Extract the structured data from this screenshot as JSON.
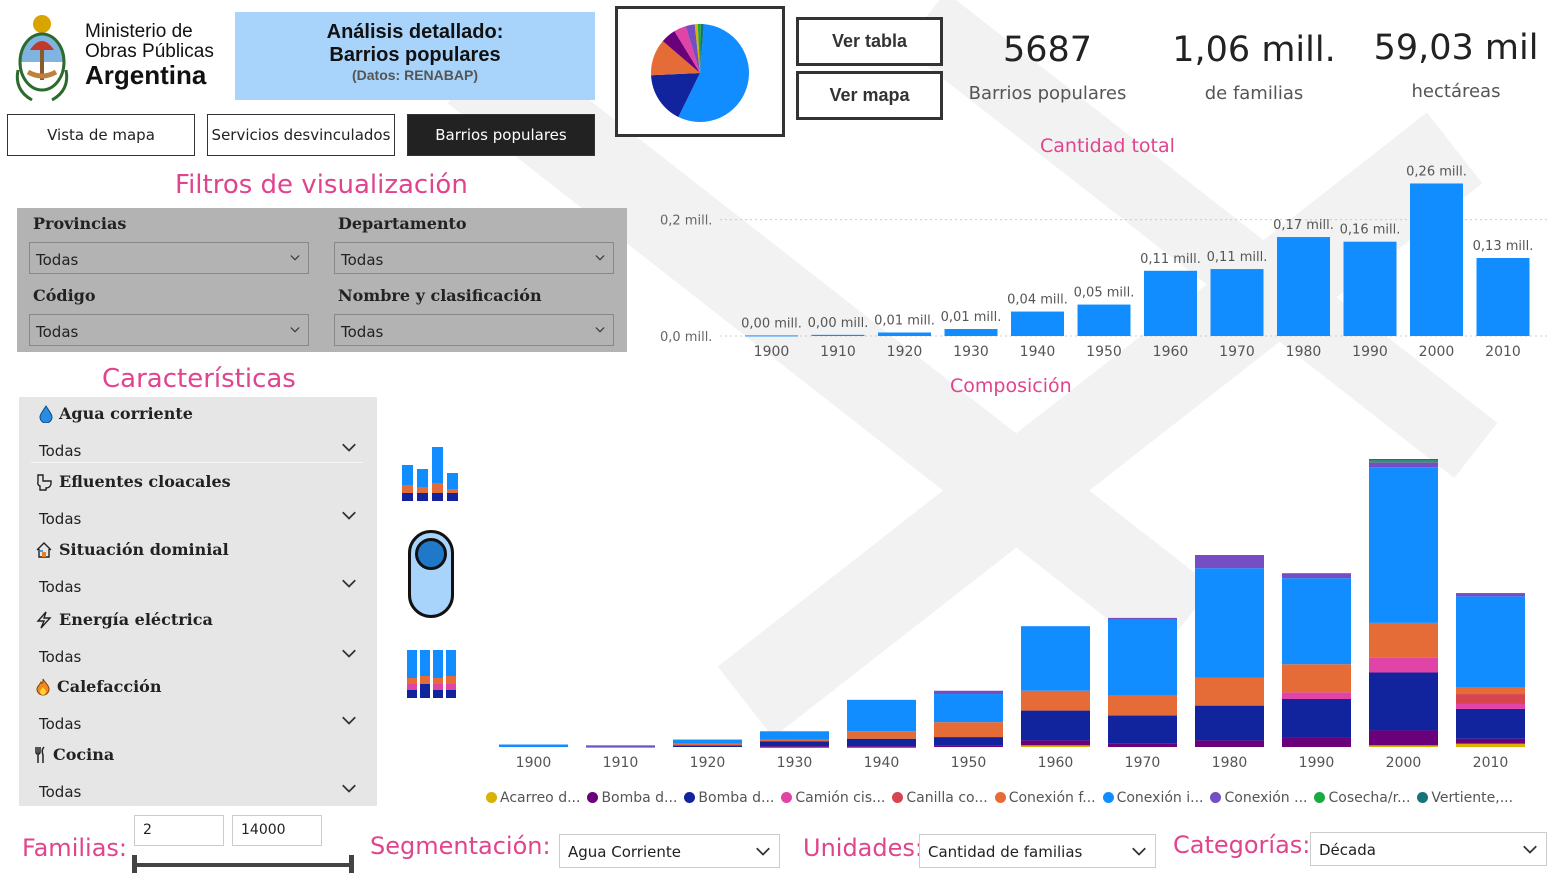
{
  "header": {
    "logo_line1": "Ministerio de",
    "logo_line2": "Obras Públicas",
    "logo_line3": "Argentina",
    "banner_title1": "Análisis detallado:",
    "banner_title2": "Barrios populares",
    "banner_sub": "(Datos: RENABAP)"
  },
  "nav": {
    "map_view": "Vista de mapa",
    "services": "Servicios desvinculados",
    "barrios": "Barrios populares"
  },
  "view_buttons": {
    "table": "Ver tabla",
    "map": "Ver mapa"
  },
  "kpis": [
    {
      "value": "5687",
      "label": "Barrios populares"
    },
    {
      "value": "1,06 mill.",
      "label": "de familias"
    },
    {
      "value": "59,03 mil",
      "label": "hectáreas"
    }
  ],
  "filters": {
    "title": "Filtros de visualización",
    "items": [
      {
        "label": "Provincias",
        "value": "Todas"
      },
      {
        "label": "Departamento",
        "value": "Todas"
      },
      {
        "label": "Código",
        "value": "Todas"
      },
      {
        "label": "Nombre y clasificación",
        "value": "Todas"
      }
    ]
  },
  "characteristics": {
    "title": "Características",
    "items": [
      {
        "label": "Agua corriente",
        "value": "Todas",
        "icon": "water-drop-icon"
      },
      {
        "label": "Efluentes cloacales",
        "value": "Todas",
        "icon": "toilet-icon"
      },
      {
        "label": "Situación dominial",
        "value": "Todas",
        "icon": "house-icon"
      },
      {
        "label": "Energía eléctrica",
        "value": "Todas",
        "icon": "lightning-icon"
      },
      {
        "label": "Calefacción",
        "value": "Todas",
        "icon": "fire-icon"
      },
      {
        "label": "Cocina",
        "value": "Todas",
        "icon": "utensils-icon"
      }
    ]
  },
  "bottom": {
    "familias_label": "Familias:",
    "familias_min": "2",
    "familias_max": "14000",
    "seg_label": "Segmentación:",
    "seg_value": "Agua Corriente",
    "units_label": "Unidades:",
    "units_value": "Cantidad de familias",
    "cat_label": "Categorías:",
    "cat_value": "Década"
  },
  "colors": {
    "blue": "#118dff",
    "navy": "#12239e",
    "orange": "#e66c37",
    "purple": "#6b007b",
    "pink": "#e044a7",
    "violet": "#744ec2",
    "yellow": "#d9b300",
    "red": "#d64550",
    "green": "#1aab40",
    "teal": "#197278",
    "accent_pink": "#e0448d"
  },
  "chart_data": [
    {
      "type": "bar",
      "title": "Cantidad total",
      "categories": [
        "1900",
        "1910",
        "1920",
        "1930",
        "1940",
        "1950",
        "1960",
        "1970",
        "1980",
        "1990",
        "2000",
        "2010"
      ],
      "values": [
        0.001,
        0.002,
        0.006,
        0.012,
        0.042,
        0.054,
        0.112,
        0.115,
        0.17,
        0.162,
        0.262,
        0.134
      ],
      "data_labels": [
        "0,00 mill.",
        "0,00 mill.",
        "0,01 mill.",
        "0,01 mill.",
        "0,04 mill.",
        "0,05 mill.",
        "0,11 mill.",
        "0,11 mill.",
        "0,17 mill.",
        "0,16 mill.",
        "0,26 mill.",
        "0,13 mill."
      ],
      "yticks": [
        "0,0 mill.",
        "0,2 mill."
      ],
      "ylim": [
        0,
        0.28
      ]
    },
    {
      "type": "bar",
      "stacked": true,
      "title": "Composición",
      "categories": [
        "1900",
        "1910",
        "1920",
        "1930",
        "1940",
        "1950",
        "1960",
        "1970",
        "1980",
        "1990",
        "2000",
        "2010"
      ],
      "series": [
        {
          "name": "Acarreo d...",
          "color": "#d9b300",
          "values": [
            0,
            0,
            0,
            0,
            0,
            0,
            1000,
            0,
            0,
            0,
            1000,
            2000
          ]
        },
        {
          "name": "Bomba d...",
          "color": "#6b007b",
          "values": [
            0,
            0,
            0,
            500,
            500,
            1000,
            3000,
            2000,
            4000,
            6000,
            9000,
            3000
          ]
        },
        {
          "name": "Bomba d...",
          "color": "#12239e",
          "values": [
            0,
            0,
            1000,
            3000,
            4500,
            5000,
            18000,
            17000,
            21000,
            23000,
            35000,
            18000
          ]
        },
        {
          "name": "Camión cis...",
          "color": "#e044a7",
          "values": [
            0,
            0,
            0,
            0,
            0,
            0,
            0,
            0,
            0,
            4000,
            9000,
            3000
          ]
        },
        {
          "name": "Canilla co...",
          "color": "#d64550",
          "values": [
            0,
            0,
            0,
            0,
            0,
            0,
            0,
            0,
            0,
            0,
            0,
            6000
          ]
        },
        {
          "name": "Conexión f...",
          "color": "#e66c37",
          "values": [
            0,
            0,
            1000,
            1000,
            4500,
            9000,
            12000,
            12000,
            17000,
            17000,
            21000,
            4000
          ]
        },
        {
          "name": "Conexión i...",
          "color": "#118dff",
          "values": [
            1500,
            500,
            2500,
            5000,
            19000,
            17000,
            39000,
            46000,
            66000,
            52000,
            94000,
            55000
          ]
        },
        {
          "name": "Conexión ...",
          "color": "#744ec2",
          "values": [
            0,
            500,
            0,
            0,
            0,
            2000,
            0,
            1000,
            8000,
            3000,
            3000,
            2000
          ]
        },
        {
          "name": "Cosecha/r...",
          "color": "#1aab40",
          "values": [
            0,
            0,
            0,
            0,
            0,
            0,
            0,
            0,
            0,
            0,
            1000,
            0
          ]
        },
        {
          "name": "Vertiente,...",
          "color": "#197278",
          "values": [
            0,
            0,
            0,
            0,
            0,
            0,
            0,
            0,
            0,
            0,
            1000,
            0
          ]
        }
      ]
    },
    {
      "type": "pie",
      "slices": [
        {
          "color": "#118dff",
          "value": 56
        },
        {
          "color": "#12239e",
          "value": 17
        },
        {
          "color": "#e66c37",
          "value": 12
        },
        {
          "color": "#6b007b",
          "value": 5
        },
        {
          "color": "#e044a7",
          "value": 4
        },
        {
          "color": "#744ec2",
          "value": 3
        },
        {
          "color": "#d9b300",
          "value": 1
        },
        {
          "color": "#1aab40",
          "value": 1
        },
        {
          "color": "#197278",
          "value": 1
        }
      ]
    }
  ]
}
